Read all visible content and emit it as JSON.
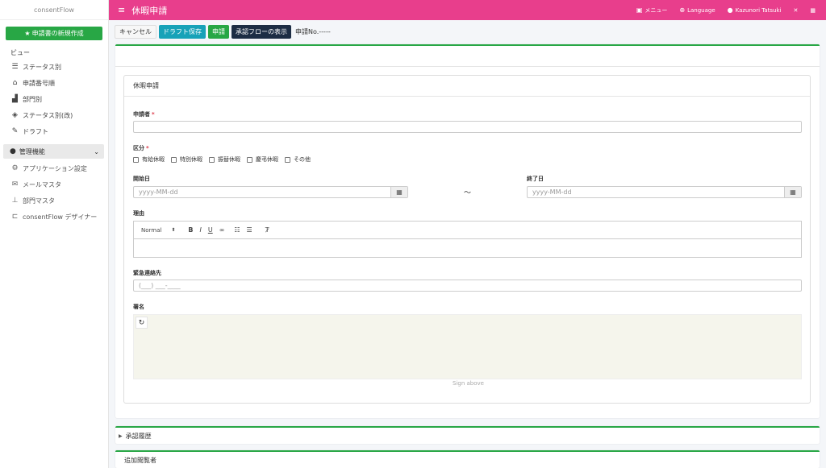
{
  "app": {
    "brand": "consentFlow",
    "title": "休暇申請"
  },
  "header": {
    "menu_label": "メニュー",
    "language_label": "Language",
    "user_name": "Kazunori Tatsuki"
  },
  "sidebar": {
    "new_button": "申請書の新規作成",
    "view_label": "ビュー",
    "view_items": [
      {
        "label": "ステータス別",
        "icon": "list-icon"
      },
      {
        "label": "申請番号順",
        "icon": "inbox-icon"
      },
      {
        "label": "部門別",
        "icon": "industry-icon"
      },
      {
        "label": "ステータス別(改)",
        "icon": "cube-icon"
      },
      {
        "label": "ドラフト",
        "icon": "edit-icon"
      }
    ],
    "admin_label": "管理機能",
    "admin_items": [
      {
        "label": "アプリケーション設定",
        "icon": "gear-icon"
      },
      {
        "label": "メールマスタ",
        "icon": "mail-icon"
      },
      {
        "label": "部門マスタ",
        "icon": "sitemap-icon"
      },
      {
        "label": "consentFlow デザイナー",
        "icon": "designer-icon"
      }
    ]
  },
  "toolbar": {
    "cancel": "キャンセル",
    "draft_save": "ドラフト保存",
    "apply": "申請",
    "show_flow": "承認フローの表示",
    "app_no": "申請No.-----"
  },
  "form": {
    "section_title": "休暇申請",
    "applicant_label": "申請者",
    "applicant_value": "",
    "category_label": "区分",
    "category_options": [
      "有給休暇",
      "特別休暇",
      "振替休暇",
      "慶弔休暇",
      "その他"
    ],
    "start_label": "開始日",
    "start_placeholder": "yyyy-MM-dd",
    "range_sep": "～",
    "end_label": "終了日",
    "end_placeholder": "yyyy-MM-dd",
    "reason_label": "理由",
    "editor_format": "Normal",
    "contact_label": "緊急連絡先",
    "contact_placeholder": "(___) ___-____",
    "signature_label": "署名",
    "sign_above": "Sign above"
  },
  "sections": {
    "history": "承認履歴",
    "extra_viewers": "追加閲覧者"
  },
  "colors": {
    "topbar": "#e83e8c",
    "accent": "#28a745",
    "info": "#17a2b8",
    "dark": "#1d2d44"
  }
}
